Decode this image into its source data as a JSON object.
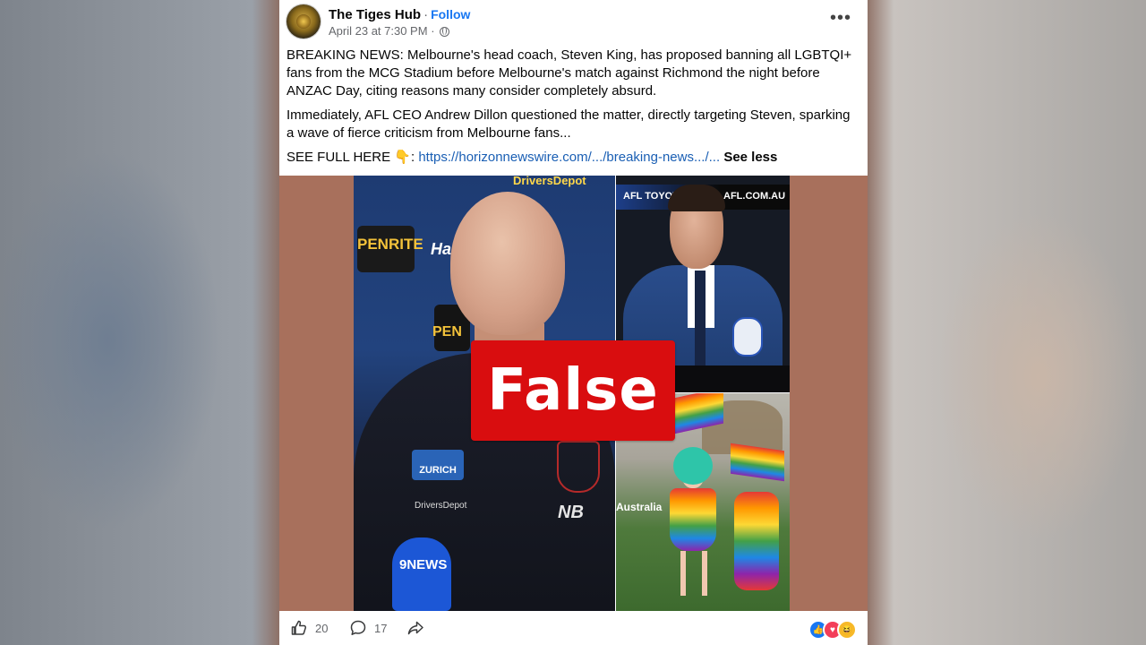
{
  "post": {
    "page_name": "The Tiges Hub",
    "separator": "·",
    "follow_label": "Follow",
    "timestamp": "April 23 at 7:30 PM",
    "meta_separator": "·",
    "more_icon": "more-options-icon",
    "privacy_icon": "globe-icon",
    "paragraph_1": "BREAKING NEWS: Melbourne's head coach, Steven King, has proposed banning all LGBTQI+ fans from the MCG Stadium before Melbourne's match against Richmond the night before ANZAC Day, citing reasons many consider completely absurd.",
    "paragraph_2": "Immediately, AFL CEO Andrew Dillon questioned the matter, directly targeting Steven, sparking a wave of fierce criticism from Melbourne fans...",
    "see_full_prefix": "SEE FULL HERE 👇: ",
    "link_text": "https://horizonnewswire.com/.../breaking-news.../...",
    "see_less_label": "See less"
  },
  "media": {
    "overlay_label": "False",
    "overlay_color": "#d90d0f",
    "signage": {
      "top_sponsor": "DriversDepot",
      "penrite": "PENRITE",
      "harcourts": "Harcourts",
      "penrite_2": "PEN",
      "zurich": "ZURICH",
      "drivers_depot_shirt": "DriversDepot",
      "nine_news": "9NEWS",
      "afl_banner_left": "AFL TOYOTA",
      "afl_banner_right": "AFL.COM.AU",
      "australia": "Australia"
    }
  },
  "actions": {
    "like_count": "20",
    "comment_count": "17",
    "share_icon": "share-icon",
    "reactions": [
      "like",
      "love",
      "haha"
    ]
  },
  "colors": {
    "link": "#1a5fb4",
    "follow": "#1877f2",
    "media_bg": "#a8705c"
  }
}
